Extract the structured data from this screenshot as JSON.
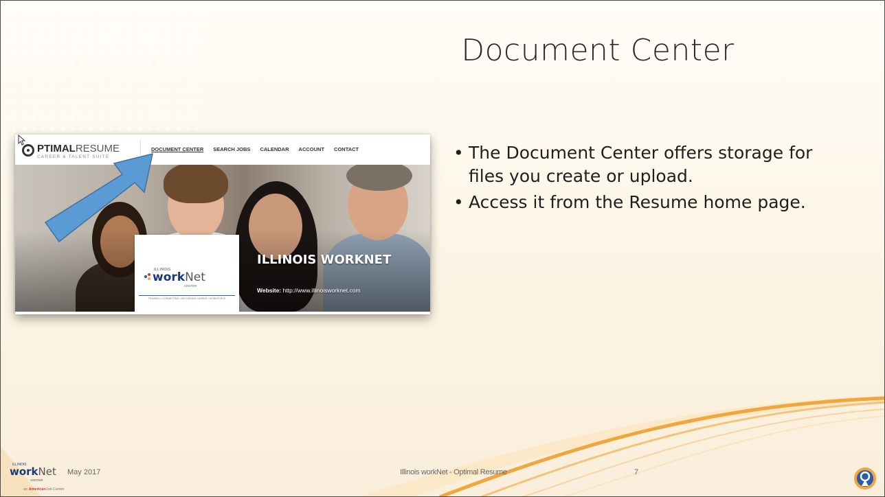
{
  "slide": {
    "title": "Document Center",
    "bullets": [
      "The Document Center offers storage for files you create or upload.",
      "Access it from the Resume home page."
    ],
    "footer": {
      "date": "May 2017",
      "center": "Illinois workNet - Optimal Resume",
      "page_number": "7"
    }
  },
  "screenshot": {
    "logo": {
      "bold": "PTIMAL",
      "light": "RESUME",
      "tagline": "CAREER & TALENT SUITE"
    },
    "nav": [
      "DOCUMENT CENTER",
      "SEARCH JOBS",
      "CALENDAR",
      "ACCOUNT",
      "CONTACT"
    ],
    "card": {
      "small": "ILLINOIS",
      "work": "work",
      "net": "Net",
      "center": "CENTER",
      "tagline": "TRAINING • CONNECTING • DELIVERING CAREER • WORKFORCE"
    },
    "banner": {
      "title": "ILLINOIS WORKNET",
      "website_label": "Website:",
      "website_url": "http://www.illinoisworknet.com"
    }
  },
  "corner_logo": {
    "small": "ILLINOIS",
    "work": "work",
    "net": "Net",
    "center": "CENTER",
    "tag_prefix": "an",
    "tag_brand": "American",
    "tag_suffix": "Job Center"
  },
  "colors": {
    "arrow": "#5b9bd5",
    "wave": "#f0a63c",
    "brand_blue": "#1b3a7a"
  }
}
